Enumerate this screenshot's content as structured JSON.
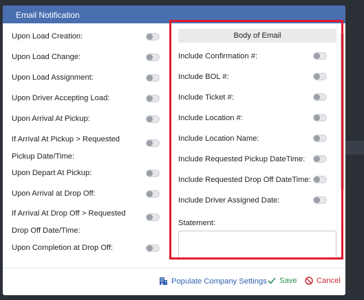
{
  "modal": {
    "title": "Email Notification"
  },
  "left_items": [
    {
      "label": "Upon Load Creation:",
      "on": false
    },
    {
      "label": "Upon Load Change:",
      "on": false
    },
    {
      "label": "Upon Load Assignment:",
      "on": false
    },
    {
      "label": "Upon Driver Accepting Load:",
      "on": false
    },
    {
      "label": "Upon Arrival At Pickup:",
      "on": false
    },
    {
      "label": "If Arrival At Pickup > Requested Pickup Date/Time:",
      "on": false
    },
    {
      "label": "Upon Depart At Pickup:",
      "on": false
    },
    {
      "label": "Upon Arrival at Drop Off:",
      "on": false
    },
    {
      "label": "If Arrival At Drop Off > Requested Drop Off Date/Time:",
      "on": false
    },
    {
      "label": "Upon Completion at Drop Off:",
      "on": false
    }
  ],
  "body_of_email": {
    "header": "Body of Email",
    "items": [
      {
        "label": "Include Confirmation #:",
        "on": false
      },
      {
        "label": "Include BOL #:",
        "on": false
      },
      {
        "label": "Include Ticket #:",
        "on": false
      },
      {
        "label": "Include Location #:",
        "on": false
      },
      {
        "label": "Include Location Name:",
        "on": false
      },
      {
        "label": "Include Requested Pickup DateTime:",
        "on": false
      },
      {
        "label": "Include Requested Drop Off DateTime:",
        "on": false
      },
      {
        "label": "Include Driver Assigned Date:",
        "on": false
      }
    ],
    "statement_label": "Statement:",
    "statement_value": ""
  },
  "footer": {
    "populate_label": "Populate Company Settings",
    "save_label": "Save",
    "cancel_label": "Cancel"
  },
  "colors": {
    "header_bg": "#4a6fb0",
    "highlight": "#e11a2a",
    "populate": "#2f5fb0",
    "save": "#2d8a4e",
    "cancel": "#c62b34"
  }
}
